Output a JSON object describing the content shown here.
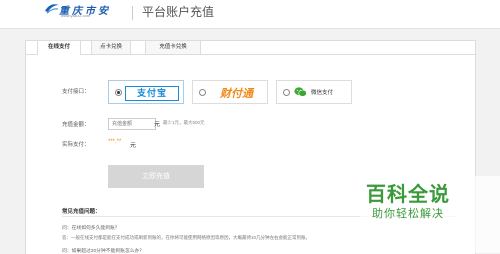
{
  "header": {
    "logo_text": "重庆市安",
    "logo_url": "www.yaa12.com",
    "title": "平台账户充值"
  },
  "tabs": [
    {
      "label": "在线支付",
      "active": true
    },
    {
      "label": "点卡兑换",
      "active": false
    },
    {
      "label": "充值卡兑换",
      "active": false
    }
  ],
  "payment": {
    "label": "支付接口：",
    "options": [
      {
        "name": "支付宝",
        "selected": true
      },
      {
        "name": "财付通",
        "selected": false
      },
      {
        "name": "微信支付",
        "selected": false
      }
    ]
  },
  "amount": {
    "label": "充值金额：",
    "placeholder": "充值金额",
    "unit": "元",
    "hint": "最少1元，最大500元"
  },
  "actual": {
    "label": "实际支付：",
    "value": "***.**",
    "unit": "元"
  },
  "submit_label": "立即充值",
  "faq": {
    "title": "常见充值问题：",
    "q1": "问：在线如何多久能到账？",
    "a1_prefix": "答：一般在线支付都是能在支付成功或刷新到账的，在你将可能使用网络原因等原因，大概最待10几分钟左右会能正常到账。",
    "q2": "问：如果超过20分钟不能到账怎么办？"
  },
  "watermark": {
    "title": "百科全说",
    "subtitle": "助你轻松解决"
  },
  "colors": {
    "alipay": "#1a8bd4",
    "caifutong": "#f08a1d",
    "wechat": "#3aa832",
    "watermark": "#3a9a3a"
  }
}
